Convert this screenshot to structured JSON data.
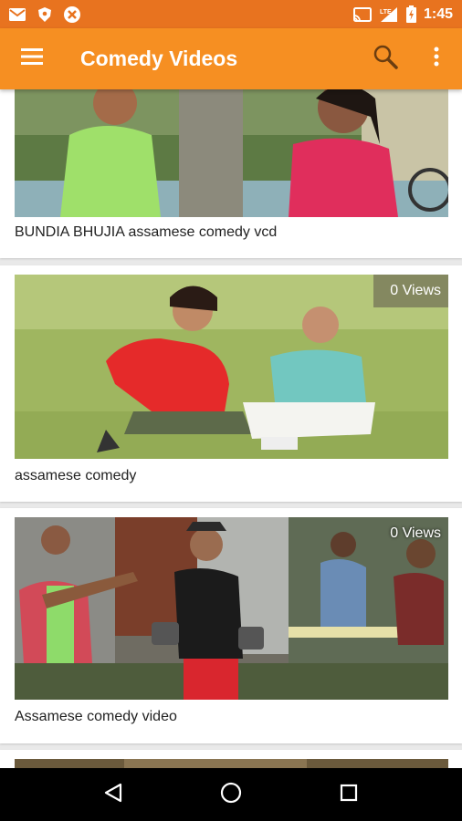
{
  "status_bar": {
    "time": "1:45",
    "left_icons": [
      "gmail-icon",
      "shield-icon",
      "app-icon"
    ],
    "right_icons": [
      "cast-icon",
      "lte-signal-icon",
      "battery-icon"
    ],
    "network_label": "LTE"
  },
  "app_bar": {
    "title": "Comedy Videos",
    "menu_icon": "hamburger-menu-icon",
    "search_icon": "search-icon",
    "overflow_icon": "more-vert-icon",
    "color": "#f68f22"
  },
  "status_bar_color": "#e8731f",
  "videos": [
    {
      "title": "BUNDIA BHUJIA assamese comedy vcd",
      "views": ""
    },
    {
      "title": "assamese comedy",
      "views": "0 Views"
    },
    {
      "title": "Assamese comedy video",
      "views": "0 Views"
    }
  ],
  "nav_bar": {
    "back_icon": "back-triangle-icon",
    "home_icon": "home-circle-icon",
    "recents_icon": "recents-square-icon"
  }
}
